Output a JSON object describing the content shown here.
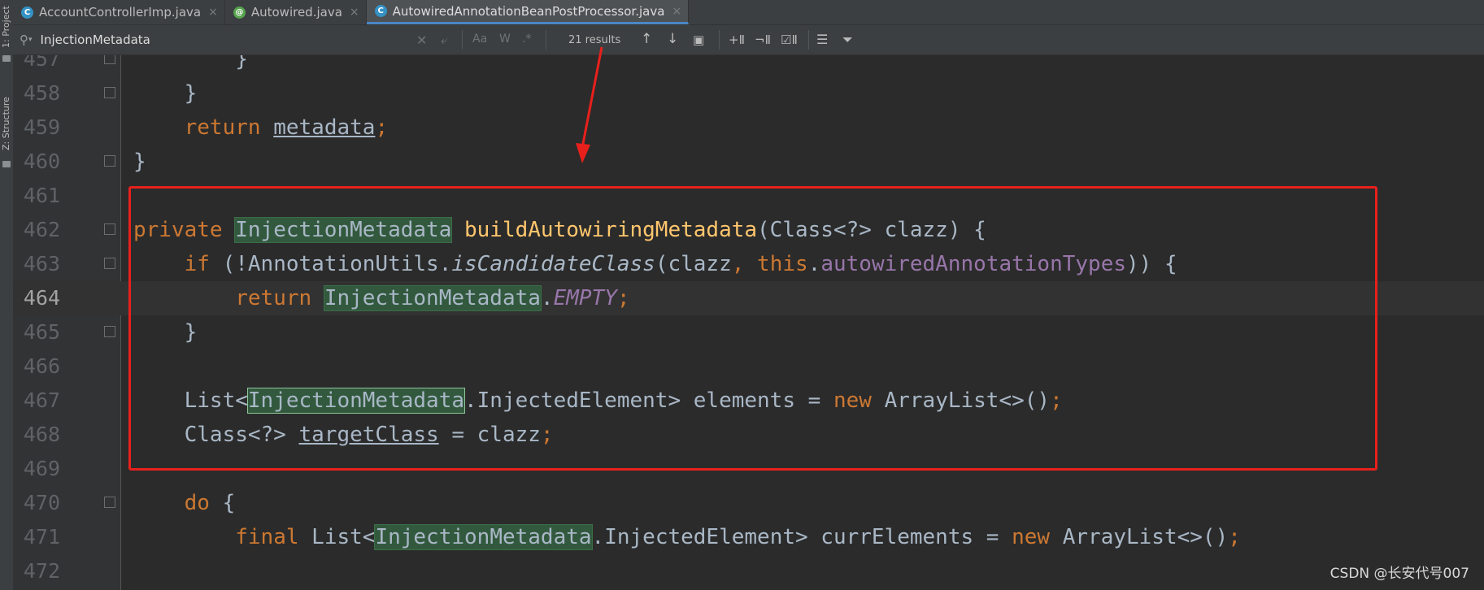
{
  "side_panel": {
    "project_label": "1: Project",
    "structure_label": "Z: Structure"
  },
  "tabs": [
    {
      "label": "AccountControllerImp.java",
      "icon": "C",
      "active": false
    },
    {
      "label": "Autowired.java",
      "icon": "@",
      "active": false
    },
    {
      "label": "AutowiredAnnotationBeanPostProcessor.java",
      "icon": "C",
      "active": true
    }
  ],
  "find": {
    "query": "InjectionMetadata",
    "match_case": "Aa",
    "words": "W",
    "regex": ".*",
    "results": "21 results"
  },
  "editor": {
    "lines": [
      {
        "n": "457"
      },
      {
        "n": "458"
      },
      {
        "n": "459"
      },
      {
        "n": "460"
      },
      {
        "n": "461"
      },
      {
        "n": "462"
      },
      {
        "n": "463"
      },
      {
        "n": "464"
      },
      {
        "n": "465"
      },
      {
        "n": "466"
      },
      {
        "n": "467"
      },
      {
        "n": "468"
      },
      {
        "n": "469"
      },
      {
        "n": "470"
      },
      {
        "n": "471"
      },
      {
        "n": "472"
      }
    ],
    "current_line": "464"
  },
  "watermark": "CSDN @长安代号007",
  "colors": {
    "background": "#2b2b2b",
    "keyword": "#cc7832",
    "method": "#ffc66d",
    "field": "#9876aa",
    "search_highlight": "#32593d",
    "annotation_red": "#e8201c"
  }
}
